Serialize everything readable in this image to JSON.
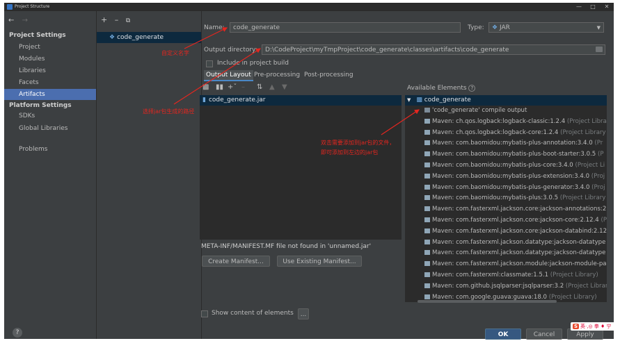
{
  "window": {
    "title": "Project Structure"
  },
  "nav": {
    "project_settings_header": "Project Settings",
    "project_items": [
      "Project",
      "Modules",
      "Libraries",
      "Facets",
      "Artifacts"
    ],
    "selected": "Artifacts",
    "platform_settings_header": "Platform Settings",
    "platform_items": [
      "SDKs",
      "Global Libraries"
    ],
    "problems": "Problems"
  },
  "artifacts_list": {
    "items": [
      "code_generate"
    ]
  },
  "form": {
    "name_label": "Name:",
    "name_value": "code_generate",
    "type_label": "Type:",
    "type_value": "JAR",
    "output_dir_label": "Output directory:",
    "output_dir_value": "D:\\CodeProject\\myTmpProject\\code_generate\\classes\\artifacts\\code_generate",
    "include_in_build_label": "Include in project build",
    "tabs": [
      "Output Layout",
      "Pre-processing",
      "Post-processing"
    ],
    "selected_tab": "Output Layout"
  },
  "output_layout": {
    "items": [
      "code_generate.jar"
    ],
    "manifest_warning": "META-INF/MANIFEST.MF file not found in 'unnamed.jar'",
    "create_manifest_button": "Create Manifest...",
    "use_existing_manifest_button": "Use Existing Manifest..."
  },
  "available": {
    "header": "Available Elements",
    "root": "code_generate",
    "compile_output": "'code_generate' compile output",
    "libraries": [
      {
        "name": "Maven: ch.qos.logback:logback-classic:1.2.4",
        "suffix": " (Project Libra"
      },
      {
        "name": "Maven: ch.qos.logback:logback-core:1.2.4",
        "suffix": " (Project Library"
      },
      {
        "name": "Maven: com.baomidou:mybatis-plus-annotation:3.4.0",
        "suffix": " (Pr"
      },
      {
        "name": "Maven: com.baomidou:mybatis-plus-boot-starter:3.0.5",
        "suffix": " (P"
      },
      {
        "name": "Maven: com.baomidou:mybatis-plus-core:3.4.0",
        "suffix": " (Project Li"
      },
      {
        "name": "Maven: com.baomidou:mybatis-plus-extension:3.4.0",
        "suffix": " (Proj"
      },
      {
        "name": "Maven: com.baomidou:mybatis-plus-generator:3.4.0",
        "suffix": " (Proj"
      },
      {
        "name": "Maven: com.baomidou:mybatis-plus:3.0.5",
        "suffix": " (Project Library"
      },
      {
        "name": "Maven: com.fasterxml.jackson.core:jackson-annotations:2",
        "suffix": ""
      },
      {
        "name": "Maven: com.fasterxml.jackson.core:jackson-core:2.12.4",
        "suffix": " (Pr"
      },
      {
        "name": "Maven: com.fasterxml.jackson.core:jackson-databind:2.12",
        "suffix": ""
      },
      {
        "name": "Maven: com.fasterxml.jackson.datatype:jackson-datatype",
        "suffix": ""
      },
      {
        "name": "Maven: com.fasterxml.jackson.datatype:jackson-datatype",
        "suffix": ""
      },
      {
        "name": "Maven: com.fasterxml.jackson.module:jackson-module-pa",
        "suffix": ""
      },
      {
        "name": "Maven: com.fasterxml:classmate:1.5.1",
        "suffix": " (Project Library)"
      },
      {
        "name": "Maven: com.github.jsqlparser:jsqlparser:3.2",
        "suffix": " (Project Librar"
      },
      {
        "name": "Maven: com.google.guava:guava:18.0",
        "suffix": " (Project Library)"
      }
    ],
    "show_content_label": "Show content of elements",
    "more_button": "..."
  },
  "annotations": {
    "name_note": "自定义名字",
    "path_note": "选择jar包生成的路径",
    "dblclick_note_1": "双击需要添加到jar包的文件，",
    "dblclick_note_2": "即可添加到左边的jar包"
  },
  "buttons": {
    "ok": "OK",
    "cancel": "Cancel",
    "apply": "Apply"
  },
  "watermark": {
    "badge": "S",
    "text": "英·,◎ 拳 ♦ 宁"
  },
  "colors": {
    "accent": "#4b6eaf",
    "annotation_red": "#e5261f",
    "background": "#3c3f41"
  }
}
